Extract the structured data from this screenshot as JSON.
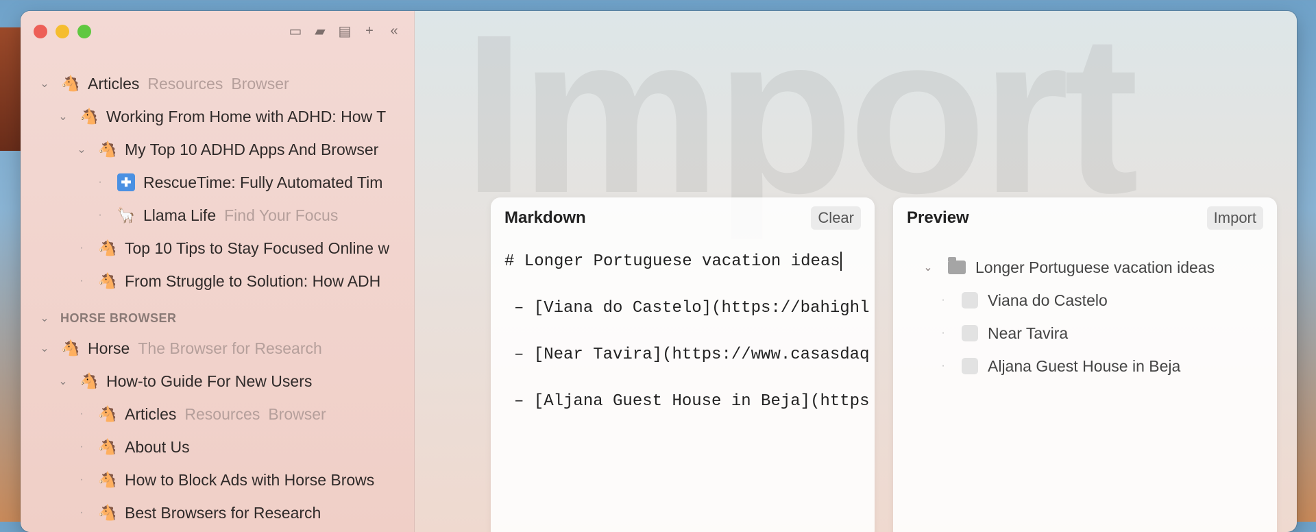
{
  "sidebar": {
    "tools": [
      "inbox-icon",
      "folder-icon",
      "note-icon",
      "plus-icon",
      "collapse-icon"
    ],
    "items": [
      {
        "title": "Articles",
        "tags": [
          "Resources",
          "Browser"
        ],
        "indent": 0,
        "kind": "chevron",
        "icon": "horse-icon"
      },
      {
        "title": "Working From Home with ADHD: How T",
        "tags": [],
        "indent": 1,
        "kind": "chevron",
        "icon": "horse-icon"
      },
      {
        "title": "My Top 10 ADHD Apps And Browser",
        "tags": [],
        "indent": 2,
        "kind": "chevron",
        "icon": "horse-icon"
      },
      {
        "title": "RescueTime: Fully Automated Tim",
        "tags": [],
        "indent": 3,
        "kind": "bullet",
        "icon": "rescuetime-icon"
      },
      {
        "title": "Llama Life",
        "tags": [
          "Find Your Focus"
        ],
        "indent": 3,
        "kind": "bullet",
        "icon": "llama-icon"
      },
      {
        "title": "Top 10 Tips to Stay Focused Online w",
        "tags": [],
        "indent": 2,
        "kind": "bullet",
        "icon": "horse-icon"
      },
      {
        "title": "From Struggle to Solution: How ADH",
        "tags": [],
        "indent": 2,
        "kind": "bullet",
        "icon": "horse-icon"
      }
    ],
    "section_header": "HORSE BROWSER",
    "items2": [
      {
        "title": "Horse",
        "tags": [
          "The Browser for Research"
        ],
        "indent": 0,
        "kind": "chevron",
        "icon": "horse-icon"
      },
      {
        "title": "How-to Guide For New Users",
        "tags": [],
        "indent": 1,
        "kind": "chevron",
        "icon": "horse-icon"
      },
      {
        "title": "Articles",
        "tags": [
          "Resources",
          "Browser"
        ],
        "indent": 2,
        "kind": "bullet",
        "icon": "horse-icon"
      },
      {
        "title": "About Us",
        "tags": [],
        "indent": 2,
        "kind": "bullet",
        "icon": "horse-icon"
      },
      {
        "title": "How to Block Ads with Horse Brows",
        "tags": [],
        "indent": 2,
        "kind": "bullet",
        "icon": "horse-icon"
      },
      {
        "title": "Best Browsers for Research",
        "tags": [],
        "indent": 2,
        "kind": "bullet",
        "icon": "horse-icon"
      }
    ]
  },
  "background_word": "Import",
  "markdown": {
    "title": "Markdown",
    "clear_label": "Clear",
    "heading_line": "# Longer Portuguese vacation ideas",
    "lines": [
      "– [Viana do Castelo](https://bahighl",
      "– [Near Tavira](https://www.casasdaq",
      "– [Aljana Guest House in Beja](https"
    ]
  },
  "preview": {
    "title": "Preview",
    "import_label": "Import",
    "folder": "Longer Portuguese vacation ideas",
    "items": [
      "Viana do Castelo",
      "Near Tavira",
      "Aljana Guest House in Beja"
    ]
  }
}
